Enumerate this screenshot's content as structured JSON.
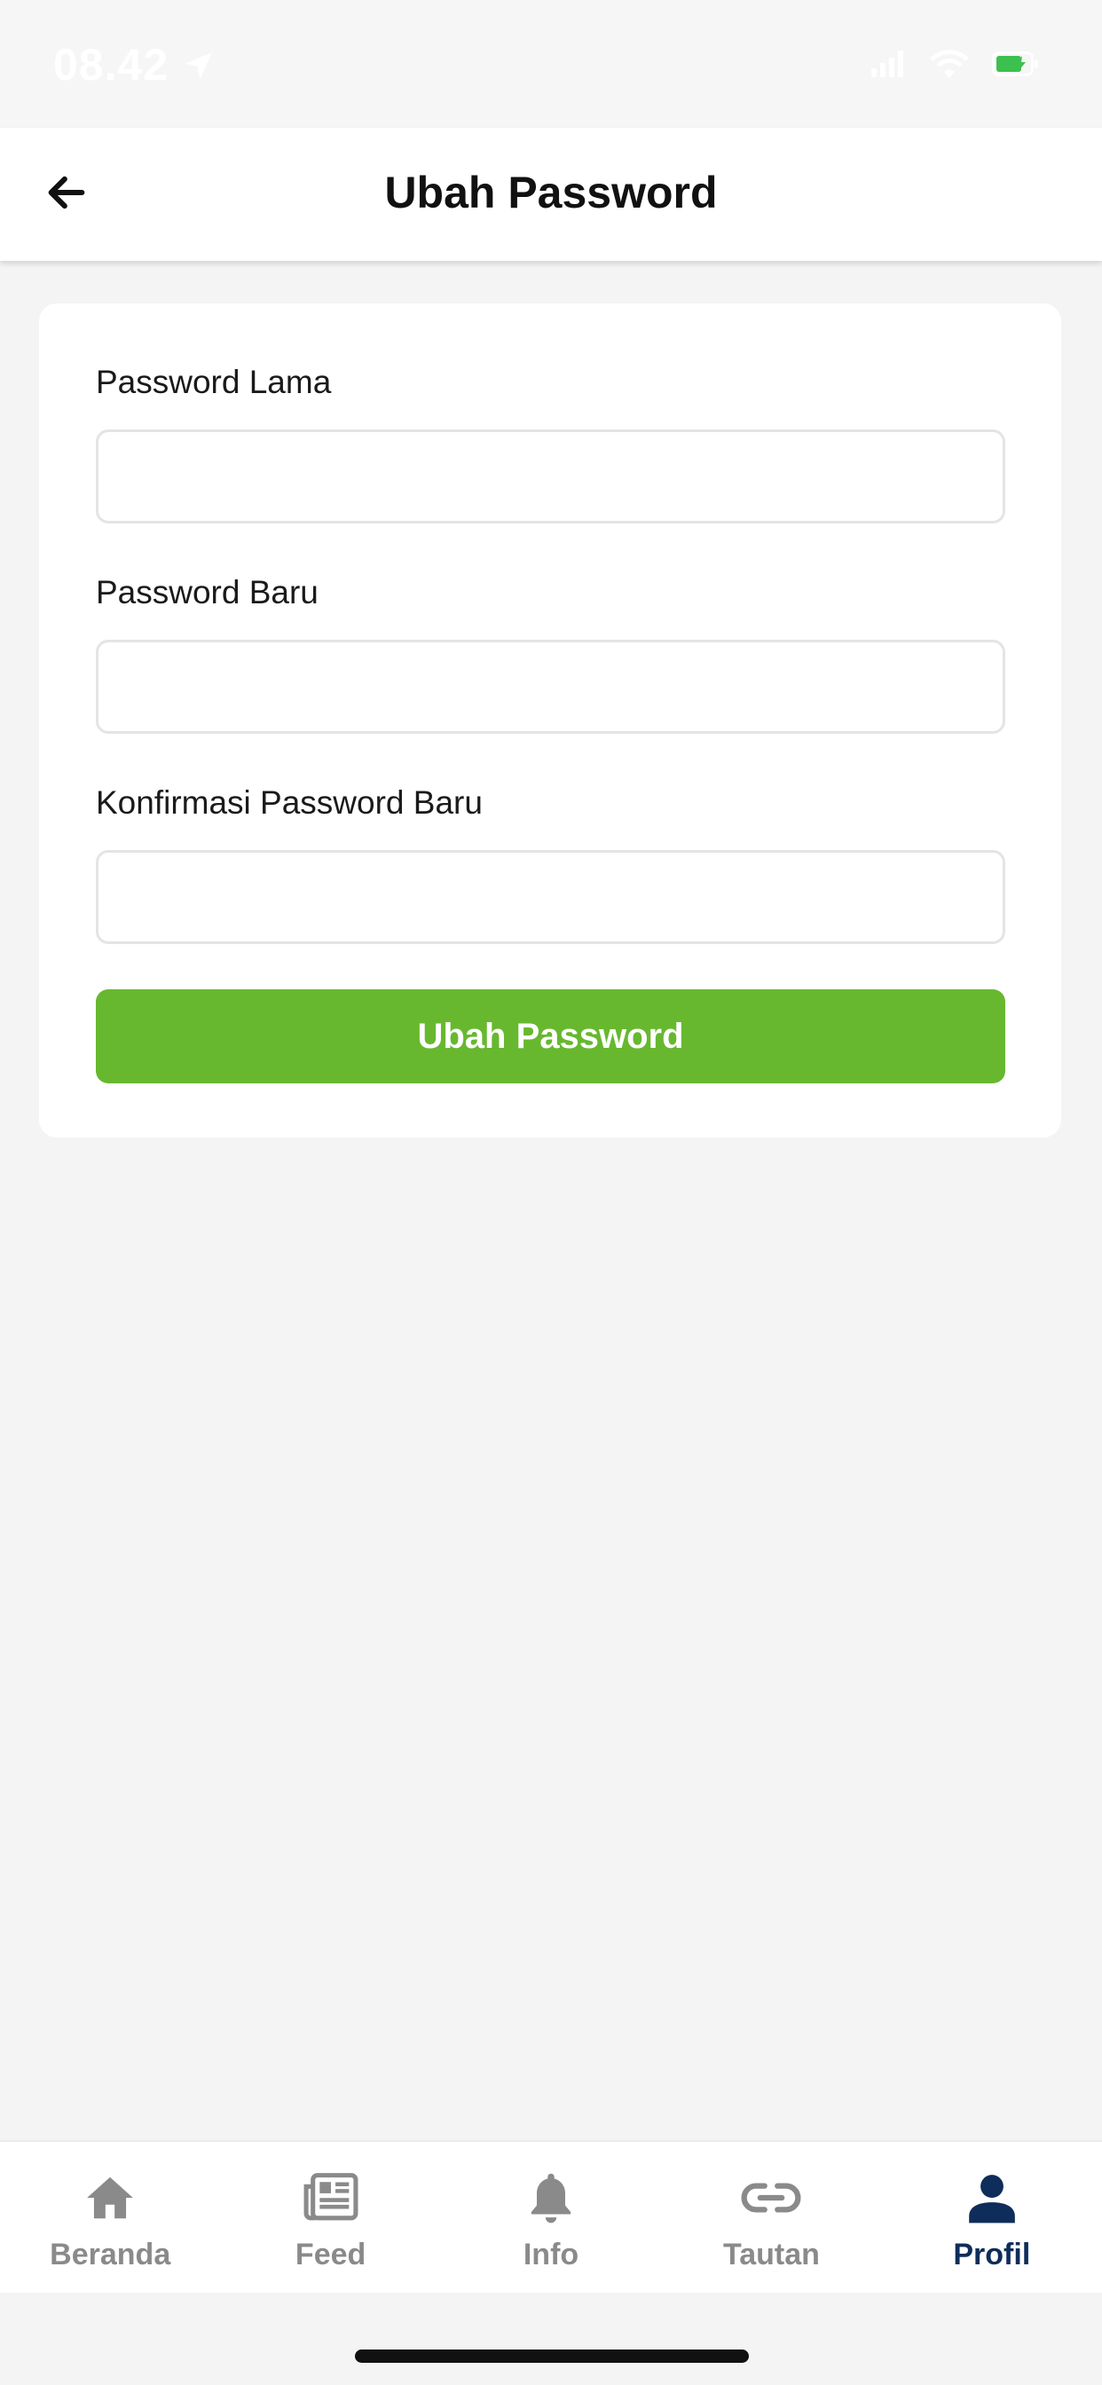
{
  "status_bar": {
    "time": "08.42",
    "icons": [
      "location-arrow-icon",
      "cellular-signal-icon",
      "wifi-icon",
      "battery-charging-icon"
    ]
  },
  "header": {
    "back_icon": "arrow-left-icon",
    "title": "Ubah Password"
  },
  "form": {
    "fields": [
      {
        "label": "Password Lama",
        "value": "",
        "placeholder": ""
      },
      {
        "label": "Password Baru",
        "value": "",
        "placeholder": ""
      },
      {
        "label": "Konfirmasi Password Baru",
        "value": "",
        "placeholder": ""
      }
    ],
    "submit_label": "Ubah Password"
  },
  "tabs": [
    {
      "label": "Beranda",
      "icon": "home-icon",
      "active": false
    },
    {
      "label": "Feed",
      "icon": "newspaper-icon",
      "active": false
    },
    {
      "label": "Info",
      "icon": "bell-icon",
      "active": false
    },
    {
      "label": "Tautan",
      "icon": "link-icon",
      "active": false
    },
    {
      "label": "Profil",
      "icon": "user-icon",
      "active": true
    }
  ],
  "colors": {
    "primary_button": "#67b82f",
    "active_tab": "#0f2d5a",
    "inactive_tab": "#8a8a8a",
    "background": "#f4f4f4",
    "battery": "#3cc04f"
  }
}
